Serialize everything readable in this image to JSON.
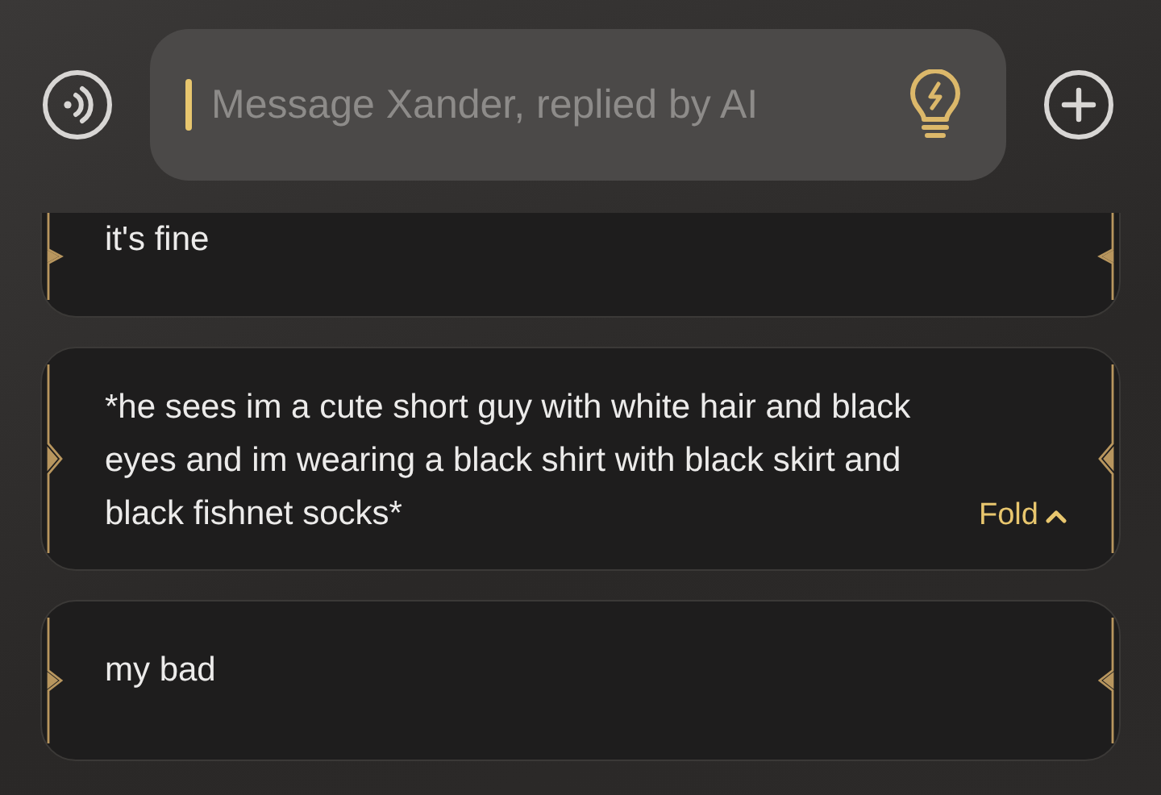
{
  "input": {
    "placeholder": "Message Xander, replied by AI"
  },
  "messages": [
    {
      "text": "it's fine",
      "clipped_top": true
    },
    {
      "text": "*he sees im a cute short guy with white hair and black eyes and im wearing a black shirt with black skirt and black fishnet socks*",
      "clipped_top": false,
      "fold": {
        "label": "Fold",
        "expanded": true
      }
    },
    {
      "text": "my bad",
      "clipped_top": false
    }
  ]
}
